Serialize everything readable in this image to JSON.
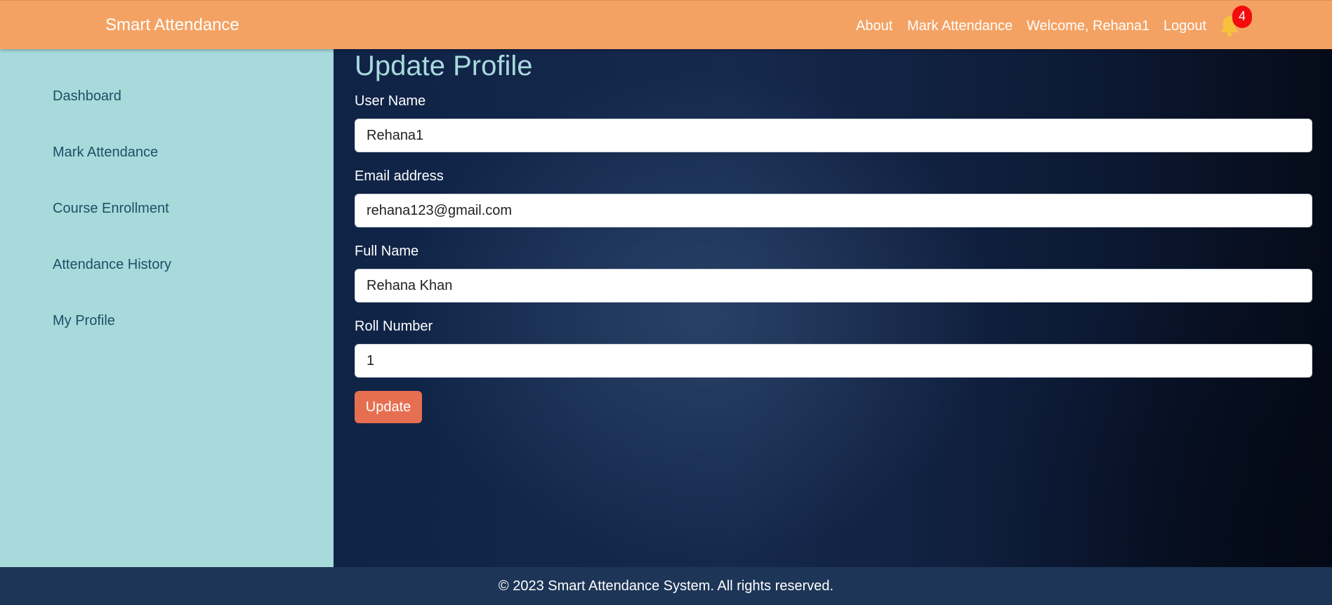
{
  "navbar": {
    "brand": "Smart Attendance",
    "links": {
      "about": "About",
      "mark_attendance": "Mark Attendance",
      "welcome": "Welcome, Rehana1",
      "logout": "Logout"
    },
    "notification_icon": "bell-icon",
    "notification_count": "4"
  },
  "sidebar": {
    "items": [
      {
        "label": "Dashboard"
      },
      {
        "label": "Mark Attendance"
      },
      {
        "label": "Course Enrollment"
      },
      {
        "label": "Attendance History"
      },
      {
        "label": "My Profile"
      }
    ]
  },
  "form": {
    "title": "Update Profile",
    "username": {
      "label": "User Name",
      "value": "Rehana1"
    },
    "email": {
      "label": "Email address",
      "value": "rehana123@gmail.com"
    },
    "fullname": {
      "label": "Full Name",
      "value": "Rehana Khan"
    },
    "roll": {
      "label": "Roll Number",
      "value": "1"
    },
    "submit_label": "Update"
  },
  "footer": {
    "text": "© 2023 Smart Attendance System. All rights reserved."
  },
  "colors": {
    "navbar": "#f4a263",
    "sidebar": "#a8dadc",
    "footer": "#1d3557",
    "button": "#e76f51",
    "badge": "#f20c0c"
  }
}
